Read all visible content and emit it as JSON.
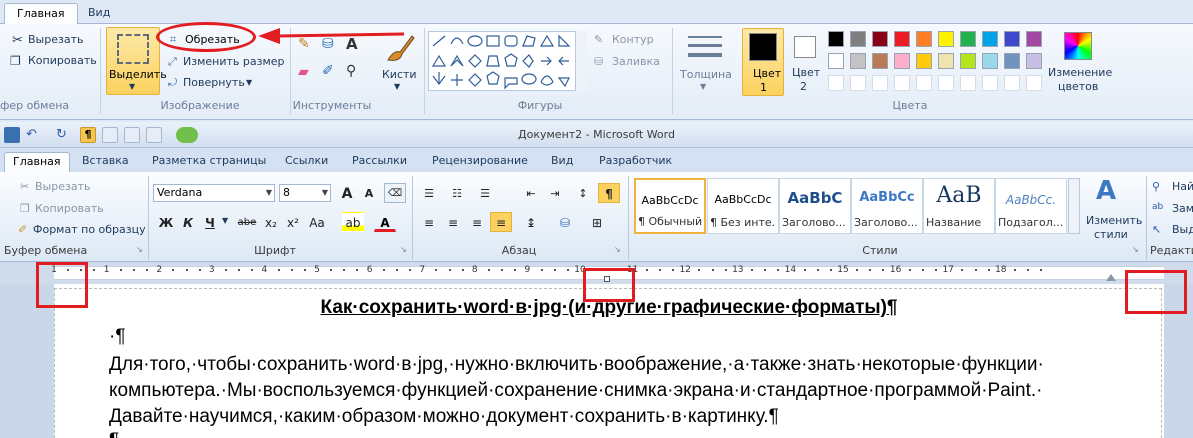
{
  "paint": {
    "tabs": [
      "Главная",
      "Вид"
    ],
    "clipboard": {
      "cut": "Вырезать",
      "copy": "Копировать",
      "label": "фер обмена"
    },
    "image": {
      "select": "Выделить",
      "crop": "Обрезать",
      "resize": "Изменить размер",
      "rotate": "Повернуть",
      "label": "Изображение"
    },
    "tools": {
      "label": "Инструменты",
      "text_tool": "A"
    },
    "brushes": {
      "label": "Кисти"
    },
    "shapes": {
      "label": "Фигуры",
      "outline": "Контур",
      "fill": "Заливка"
    },
    "size": {
      "label": "Толщина"
    },
    "color1": {
      "label": "Цвет",
      "num": "1"
    },
    "color2": {
      "label": "Цвет",
      "num": "2"
    },
    "edit_colors": {
      "line1": "Изменение",
      "line2": "цветов"
    },
    "colors_label": "Цвета",
    "palette_row1": [
      "#000000",
      "#7f7f7f",
      "#880015",
      "#ed1c24",
      "#ff7f27",
      "#fff200",
      "#22b14c",
      "#00a2e8",
      "#3f48cc",
      "#a349a4"
    ],
    "palette_row2": [
      "#ffffff",
      "#c3c3c3",
      "#b97a57",
      "#ffaec9",
      "#ffc90e",
      "#efe4b0",
      "#b5e61d",
      "#99d9ea",
      "#7092be",
      "#c8bfe7"
    ]
  },
  "word": {
    "title": "Документ2 - Microsoft Word",
    "tabs": [
      "Главная",
      "Вставка",
      "Разметка страницы",
      "Ссылки",
      "Рассылки",
      "Рецензирование",
      "Вид",
      "Разработчик"
    ],
    "clipboard": {
      "cut": "Вырезать",
      "copy": "Копировать",
      "format_painter": "Формат по образцу",
      "label": "Буфер обмена"
    },
    "font": {
      "name": "Verdana",
      "size": "8",
      "label": "Шрифт",
      "bold": "Ж",
      "italic": "К",
      "underline": "Ч",
      "strike": "abe",
      "sub": "x₂",
      "sup": "x²",
      "case": "Aa",
      "grow": "A",
      "shrink": "A",
      "color": "A"
    },
    "paragraph": {
      "label": "Абзац"
    },
    "styles": {
      "label": "Стили",
      "items": [
        {
          "sample": "AaBbCcDc",
          "name": "¶ Обычный"
        },
        {
          "sample": "AaBbCcDc",
          "name": "¶ Без инте..."
        },
        {
          "sample": "AaBbC",
          "name": "Заголово..."
        },
        {
          "sample": "AaBbCc",
          "name": "Заголово..."
        },
        {
          "sample": "AaB",
          "name": "Название"
        },
        {
          "sample": "AaBbCc.",
          "name": "Подзагол..."
        }
      ],
      "change": {
        "line1": "Изменить",
        "line2": "стили"
      }
    },
    "editing": {
      "find": "Най",
      "replace": "Зам",
      "select": "Выд",
      "label": "Редакти"
    }
  },
  "ruler": {
    "numbers": [
      "1",
      "1",
      "2",
      "3",
      "4",
      "5",
      "6",
      "7",
      "8",
      "9",
      "10",
      "11",
      "12",
      "13",
      "14",
      "15",
      "16",
      "17",
      "18"
    ]
  },
  "document": {
    "title": "Как·сохранить·word·в·jpg·(и·другие·графические·форматы)¶",
    "lines": [
      "·¶",
      "Для·того,·чтобы·сохранить·word·в·jpg,·нужно·включить·воображение,·а·также·знать·некоторые·функции·",
      "компьютера.·Мы·воспользуемся·функцией·сохранение·снимка·экрана·и·стандартное·программой·Paint.·",
      "Давайте·научимся,·каким·образом·можно·документ·сохранить·в·картинку.¶",
      "¶"
    ]
  }
}
